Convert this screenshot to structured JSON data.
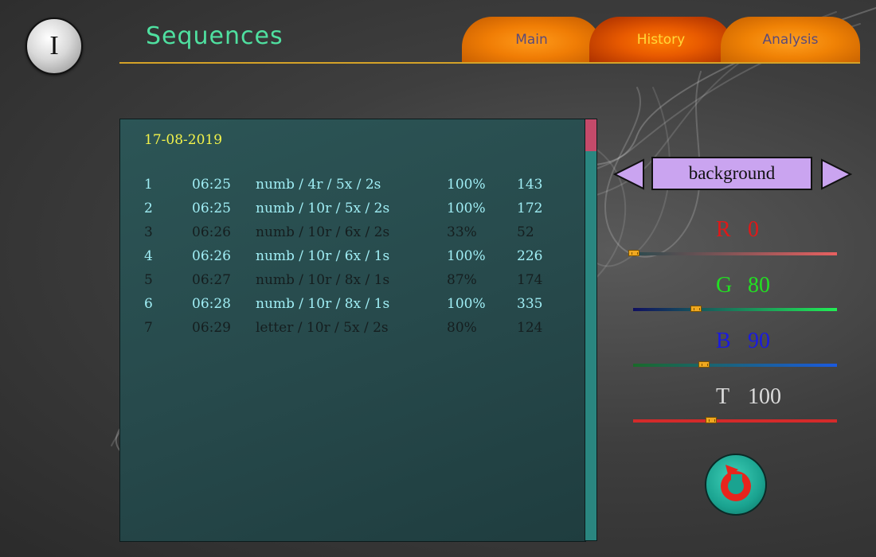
{
  "app": {
    "info_label": "I",
    "title": "Sequences"
  },
  "tabs": [
    {
      "label": "Main",
      "active": false
    },
    {
      "label": "History",
      "active": true
    },
    {
      "label": "Analysis",
      "active": false
    }
  ],
  "history": {
    "date": "17-08-2019",
    "rows": [
      {
        "num": "1",
        "time": "06:25",
        "desc": "numb   /  4r   /  5x   /  2s",
        "percent": "100%",
        "score": "143",
        "status": "pass"
      },
      {
        "num": "2",
        "time": "06:25",
        "desc": "numb   /  10r /  5x   /  2s",
        "percent": "100%",
        "score": "172",
        "status": "pass"
      },
      {
        "num": "3",
        "time": "06:26",
        "desc": "numb   /  10r /  6x   /  2s",
        "percent": "33%",
        "score": "52",
        "status": "fail"
      },
      {
        "num": "4",
        "time": "06:26",
        "desc": "numb   /  10r /  6x   /  1s",
        "percent": "100%",
        "score": "226",
        "status": "pass"
      },
      {
        "num": "5",
        "time": "06:27",
        "desc": "numb   /  10r /  8x   /  1s",
        "percent": "87%",
        "score": "174",
        "status": "fail"
      },
      {
        "num": "6",
        "time": "06:28",
        "desc": "numb   /  10r /  8x   /  1s",
        "percent": "100%",
        "score": "335",
        "status": "pass"
      },
      {
        "num": "7",
        "time": "06:29",
        "desc": "letter    /  10r /  5x   /  2s",
        "percent": "80%",
        "score": "124",
        "status": "fail"
      }
    ]
  },
  "color_settings": {
    "target_label": "background",
    "channels": [
      {
        "letter": "R",
        "value": "0",
        "fraction": 0.0,
        "color": "#e01818"
      },
      {
        "letter": "G",
        "value": "80",
        "fraction": 0.314,
        "color": "#22e022"
      },
      {
        "letter": "B",
        "value": "90",
        "fraction": 0.353,
        "color": "#1a1ae0"
      },
      {
        "letter": "T",
        "value": "100",
        "fraction": 0.392,
        "color": "#dcdcdc"
      }
    ]
  },
  "icons": {
    "arrow_left": "triangle-left-icon",
    "arrow_right": "triangle-right-icon",
    "reset": "reset-arrow-icon"
  },
  "theme": {
    "accent_title": "#4fe0a0",
    "date_color": "#f3f34a",
    "row_pass_color": "#a0eef5",
    "row_fail_color": "#151e1f",
    "tab_active_text": "#ffd83a"
  }
}
